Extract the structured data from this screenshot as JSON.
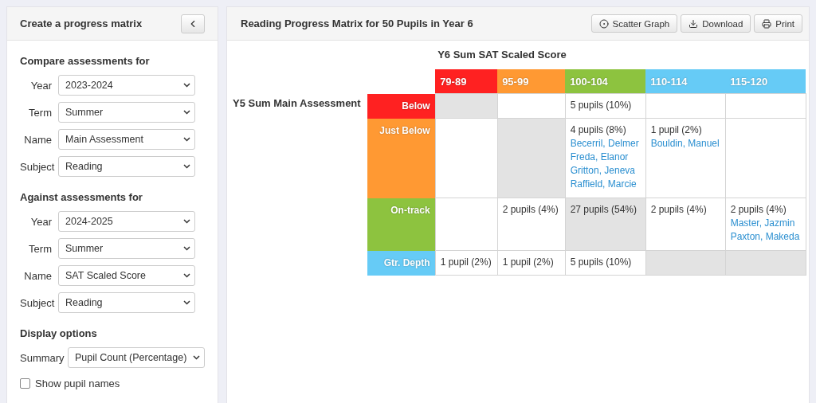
{
  "sidebar": {
    "title": "Create a progress matrix",
    "sections": [
      {
        "heading": "Compare assessments for",
        "fields": [
          {
            "label": "Year",
            "value": "2023-2024"
          },
          {
            "label": "Term",
            "value": "Summer"
          },
          {
            "label": "Name",
            "value": "Main Assessment"
          },
          {
            "label": "Subject",
            "value": "Reading"
          }
        ]
      },
      {
        "heading": "Against assessments for",
        "fields": [
          {
            "label": "Year",
            "value": "2024-2025"
          },
          {
            "label": "Term",
            "value": "Summer"
          },
          {
            "label": "Name",
            "value": "SAT Scaled Score"
          },
          {
            "label": "Subject",
            "value": "Reading"
          }
        ]
      }
    ],
    "display_options": {
      "heading": "Display options",
      "summary": {
        "label": "Summary",
        "value": "Pupil Count (Percentage)"
      },
      "show_names": {
        "label": "Show pupil names",
        "checked": false
      }
    }
  },
  "main": {
    "title": "Reading Progress Matrix for 50 Pupils in Year 6",
    "buttons": [
      {
        "kind": "scatter",
        "label": "Scatter Graph"
      },
      {
        "kind": "download",
        "label": "Download"
      },
      {
        "kind": "print",
        "label": "Print"
      }
    ],
    "matrix": {
      "column_title": "Y6 Sum SAT Scaled Score",
      "row_title": "Y5 Sum Main Assessment",
      "columns": [
        {
          "label": "79-89",
          "color": "#ff2121"
        },
        {
          "label": "95-99",
          "color": "#ff9933"
        },
        {
          "label": "100-104",
          "color": "#8dc33f"
        },
        {
          "label": "110-114",
          "color": "#66cbf6"
        },
        {
          "label": "115-120",
          "color": "#66cbf6"
        }
      ],
      "rows": [
        {
          "label": "Below",
          "color": "#ff2121",
          "cells": [
            {
              "shaded": true
            },
            {
              "shaded": false
            },
            {
              "shaded": false,
              "count": "5 pupils (10%)"
            },
            {
              "shaded": false
            },
            {
              "shaded": false
            }
          ]
        },
        {
          "label": "Just Below",
          "color": "#ff9933",
          "cells": [
            {
              "shaded": false
            },
            {
              "shaded": true
            },
            {
              "shaded": false,
              "count": "4 pupils (8%)",
              "names": [
                "Becerril, Delmer",
                "Freda, Elanor",
                "Gritton, Jeneva",
                "Raffield, Marcie"
              ]
            },
            {
              "shaded": false,
              "count": "1 pupil (2%)",
              "names": [
                "Bouldin, Manuel"
              ]
            },
            {
              "shaded": false
            }
          ]
        },
        {
          "label": "On-track",
          "color": "#8dc33f",
          "cells": [
            {
              "shaded": false
            },
            {
              "shaded": false,
              "count": "2 pupils (4%)"
            },
            {
              "shaded": true,
              "count": "27 pupils (54%)"
            },
            {
              "shaded": false,
              "count": "2 pupils (4%)"
            },
            {
              "shaded": false,
              "count": "2 pupils (4%)",
              "names": [
                "Master, Jazmin",
                "Paxton, Makeda"
              ]
            }
          ]
        },
        {
          "label": "Gtr. Depth",
          "color": "#66cbf6",
          "cells": [
            {
              "shaded": false,
              "count": "1 pupil (2%)"
            },
            {
              "shaded": false,
              "count": "1 pupil (2%)"
            },
            {
              "shaded": false,
              "count": "5 pupils (10%)"
            },
            {
              "shaded": true
            },
            {
              "shaded": true
            }
          ]
        }
      ]
    }
  }
}
